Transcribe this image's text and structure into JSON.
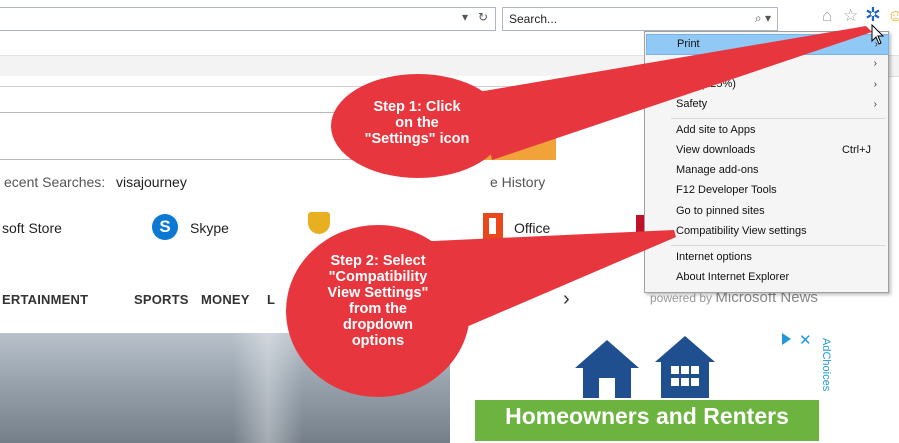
{
  "browser": {
    "search_placeholder": "Search...",
    "url_dropdown": "▾",
    "refresh_glyph": "↻",
    "search_glyph": "⌕",
    "search_dropdown": "▾"
  },
  "toolbar_icons": [
    "home-icon",
    "star-icon",
    "gear-icon",
    "smiley-icon"
  ],
  "menu": {
    "items": [
      {
        "label": "Print",
        "highlighted": true,
        "submenu": true
      },
      {
        "label": "",
        "submenu": true
      },
      {
        "label": "oom (125%)",
        "submenu": true
      },
      {
        "label": "Safety",
        "submenu": true
      },
      {
        "label": "Add site to Apps"
      },
      {
        "label": "View downloads",
        "shortcut": "Ctrl+J"
      },
      {
        "label": "Manage add-ons"
      },
      {
        "label": "F12 Developer Tools"
      },
      {
        "label": "Go to pinned sites"
      },
      {
        "label": "Compatibility View settings"
      },
      {
        "label": "Internet options"
      },
      {
        "label": "About Internet Explorer"
      }
    ]
  },
  "callouts": {
    "step1": {
      "l1": "Step 1: Click",
      "l2": "on the",
      "l3": "\"Settings\" icon"
    },
    "step2": {
      "l1": "Step 2: Select",
      "l2": "\"Compatibility",
      "l3": "View Settings\"",
      "l4": "from the",
      "l5": "dropdown",
      "l6": "options"
    }
  },
  "page": {
    "recent_label": "ecent Searches:",
    "recent_term": "visajourney",
    "history_label": "e History",
    "quick_links": {
      "store": "soft Store",
      "skype": "Skype",
      "skype_letter": "S",
      "office": "Office"
    },
    "nav": {
      "entertainment": "ERTAINMENT",
      "sports": "SPORTS",
      "money": "MONEY",
      "partial": "L"
    },
    "nav_next": "›",
    "powered_prefix": "powered by",
    "powered_brand": "Microsoft News"
  },
  "ad": {
    "close": "✕",
    "adchoices": "AdChoices",
    "headline": "Homeowners and Renters",
    "colors": {
      "banner": "#6cb33f",
      "house": "#1f4f8f"
    }
  },
  "colors": {
    "callout": "#e8363e",
    "menu_highlight": "#90c8f6",
    "gear": "#1c63c2"
  }
}
